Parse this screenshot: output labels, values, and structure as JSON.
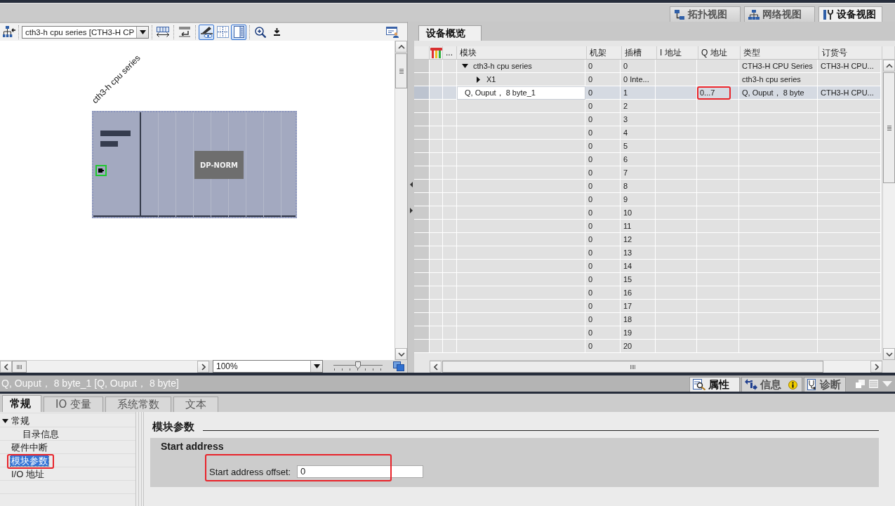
{
  "view_tabs": [
    {
      "kind": "topology",
      "label": "拓扑视图",
      "selected": false
    },
    {
      "kind": "network",
      "label": "网络视图",
      "selected": false
    },
    {
      "kind": "device",
      "label": "设备视图",
      "selected": true
    }
  ],
  "editor": {
    "device_select": {
      "value": "cth3-h cpu series [CTH3-H CP"
    },
    "tools": [
      {
        "kind": "width",
        "on": false
      },
      {
        "kind": "name",
        "on": false
      },
      {
        "kind": "eye",
        "on": true
      },
      {
        "kind": "grid",
        "on": false
      },
      {
        "kind": "panel",
        "on": true
      },
      {
        "kind": "zoom",
        "on": false
      },
      {
        "kind": "download",
        "on": false
      }
    ],
    "canvas": {
      "device_label": "cth3-h cpu series",
      "module_label": "DP-NORM"
    },
    "zoom": {
      "value": "100%"
    },
    "zoom_slider": {
      "level": 0.5
    }
  },
  "overview": {
    "tab": {
      "label": "设备概览",
      "selected": true
    },
    "columns": [
      "...",
      "模块",
      "机架",
      "插槽",
      "I 地址",
      "Q 地址",
      "类型",
      "订货号"
    ],
    "rows": [
      {
        "module": "cth3-h cpu series",
        "rack": "0",
        "slot": "0",
        "type": "CTH3-H CPU Series",
        "order_number": "CTH3-H CPU...",
        "selected": false,
        "expanded": true,
        "children": [
          {
            "module": "X1",
            "rack": "0",
            "slot": "0 Inte...",
            "type": "cth3-h cpu series",
            "selected": false,
            "expanded": false
          }
        ]
      },
      {
        "module": "Q, Ouput， 8 byte_1",
        "rack": "0",
        "slot": "1",
        "q_address": "0...7",
        "type": "Q, Ouput， 8 byte",
        "order_number": "CTH3-H CPU...",
        "selected": true,
        "highlighted": true
      },
      {
        "rack": "0",
        "slot": "2",
        "selected": false
      },
      {
        "rack": "0",
        "slot": "3",
        "selected": false
      },
      {
        "rack": "0",
        "slot": "4",
        "selected": false
      },
      {
        "rack": "0",
        "slot": "5",
        "selected": false
      },
      {
        "rack": "0",
        "slot": "6",
        "selected": false
      },
      {
        "rack": "0",
        "slot": "7",
        "selected": false
      },
      {
        "rack": "0",
        "slot": "8",
        "selected": false
      },
      {
        "rack": "0",
        "slot": "9",
        "selected": false
      },
      {
        "rack": "0",
        "slot": "10",
        "selected": false
      },
      {
        "rack": "0",
        "slot": "11",
        "selected": false
      },
      {
        "rack": "0",
        "slot": "12",
        "selected": false
      },
      {
        "rack": "0",
        "slot": "13",
        "selected": false
      },
      {
        "rack": "0",
        "slot": "14",
        "selected": false
      },
      {
        "rack": "0",
        "slot": "15",
        "selected": false
      },
      {
        "rack": "0",
        "slot": "16",
        "selected": false
      },
      {
        "rack": "0",
        "slot": "17",
        "selected": false
      },
      {
        "rack": "0",
        "slot": "18",
        "selected": false
      },
      {
        "rack": "0",
        "slot": "19",
        "selected": false
      },
      {
        "rack": "0",
        "slot": "20",
        "selected": false
      }
    ]
  },
  "inspector": {
    "title": "Q, Ouput， 8 byte_1 [Q, Ouput， 8 byte]",
    "panel_tabs": [
      {
        "kind": "properties",
        "label": "属性",
        "selected": true
      },
      {
        "kind": "info",
        "label": "信息",
        "selected": false
      },
      {
        "kind": "diagnostics",
        "label": "诊断",
        "selected": false
      }
    ],
    "tabs": [
      {
        "label": "常规",
        "selected": true
      },
      {
        "label": "IO 变量",
        "selected": false
      },
      {
        "label": "系统常数",
        "selected": false
      },
      {
        "label": "文本",
        "selected": false
      }
    ],
    "nav": [
      {
        "label": "常规",
        "selected": false,
        "expanded": true,
        "children": [
          {
            "label": "目录信息",
            "selected": false
          }
        ]
      },
      {
        "label": "硬件中断",
        "selected": false
      },
      {
        "label": "模块参数",
        "selected": true,
        "highlighted": true
      },
      {
        "label": "I/O 地址",
        "selected": false
      }
    ],
    "section": {
      "title": "模块参数",
      "group": {
        "title": "Start address",
        "fields": [
          {
            "label": "Start address offset:",
            "value": "0",
            "highlighted": true
          }
        ]
      }
    }
  }
}
